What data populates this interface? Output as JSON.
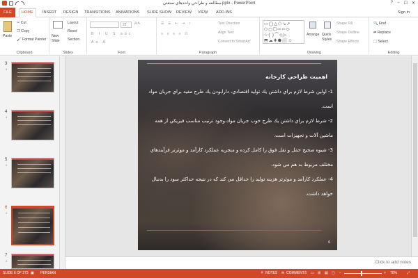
{
  "window": {
    "title": "مطالعه و طراحي واحدهاي صنعتي.pptx - PowerPoint",
    "controls": [
      "?",
      "−",
      "☐",
      "✕"
    ]
  },
  "tabs": [
    "FILE",
    "HOME",
    "INSERT",
    "DESIGN",
    "TRANSITIONS",
    "ANIMATIONS",
    "SLIDE SHOW",
    "REVIEW",
    "VIEW",
    "ADD-INS"
  ],
  "signin": "Sign in",
  "ribbon": {
    "clipboard": {
      "paste": "Paste",
      "cut": "Cut",
      "copy": "Copy",
      "format_painter": "Format Painter",
      "label": "Clipboard"
    },
    "slides": {
      "new_slide": "New Slide",
      "layout": "Layout",
      "reset": "Reset",
      "section": "Section",
      "label": "Slides"
    },
    "font": {
      "size": "22",
      "label": "Font"
    },
    "paragraph": {
      "text_direction": "Text Direction",
      "align_text": "Align Text",
      "smartart": "Convert to SmartArt",
      "label": "Paragraph"
    },
    "drawing": {
      "arrange": "Arrange",
      "quick_styles": "Quick Styles",
      "shape_fill": "Shape Fill",
      "shape_outline": "Shape Outline",
      "shape_effects": "Shape Effects",
      "label": "Drawing"
    },
    "editing": {
      "find": "Find",
      "replace": "Replace",
      "select": "Select",
      "label": "Editing"
    }
  },
  "thumbnails": [
    {
      "num": "3"
    },
    {
      "num": "4"
    },
    {
      "num": "5"
    },
    {
      "num": "6",
      "selected": true
    },
    {
      "num": "7"
    }
  ],
  "slide": {
    "title": "اهميت طراحي كارخانه",
    "paragraphs": [
      "1- اولين شرط لازم براي داشتن يك توليد اقتصادي، دارابودن يك طرح مفيد براي جريان مواد است.",
      "2- شرط لازم براي داشتن يك طرح خوب جريان مواد،وجود ترتيب مناسب فيزيكي از همه ماشين آلات و تجهيزات است.",
      "3- شيوه صحيح حمل و نقل فوق را كامل كرده و منجربه عملكرد كارآمد و موثرتر فرآيندهاي مختلف مربوط به هم مي شود.",
      "4- عملكرد كارآمد و موثرتر هزينه توليد را حداقل مي كند كه در نتيجه حداكثر سود را بدنبال خواهد داشت."
    ],
    "page_number": "6"
  },
  "notes_hint": "Click to add notes",
  "status": {
    "slide": "SLIDE 6 OF 273",
    "language": "PERSIAN",
    "notes": "NOTES",
    "comments": "COMMENTS",
    "zoom": "70%",
    "minus": "−",
    "plus": "+"
  }
}
